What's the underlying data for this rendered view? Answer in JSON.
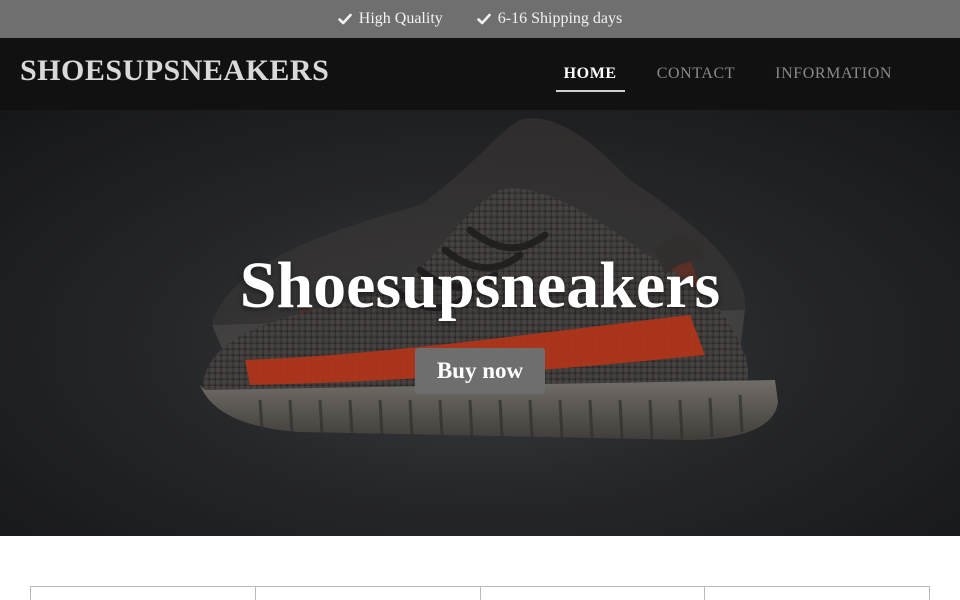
{
  "topbar": {
    "features": [
      {
        "icon": "check-icon",
        "label": "High Quality"
      },
      {
        "icon": "check-icon",
        "label": "6-16 Shipping days"
      }
    ]
  },
  "header": {
    "brand": "SHOESUPSNEAKERS",
    "nav": [
      {
        "label": "HOME",
        "active": true
      },
      {
        "label": "CONTACT",
        "active": false
      },
      {
        "label": "INFORMATION",
        "active": false
      }
    ]
  },
  "hero": {
    "title": "Shoesupsneakers",
    "button_label": "Buy now",
    "image": "sneaker-photo"
  },
  "colors": {
    "topbar_bg": "#6f6f6f",
    "header_bg": "#111111",
    "button_bg": "#6e6e6e",
    "shoe_stripe": "#d9401f"
  }
}
